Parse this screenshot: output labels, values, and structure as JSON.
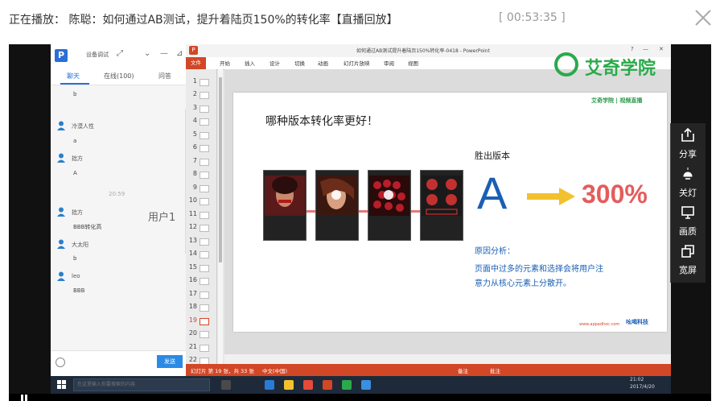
{
  "header": {
    "now_playing": "正在播放： 陈聪：如何通过AB测试，提升着陆页150%的转化率【直播回放】",
    "elapsed": "[ 00:53:35 ]"
  },
  "chat": {
    "device_test": "设备调试",
    "tabs": [
      "聊天",
      "在线(100)",
      "问答"
    ],
    "messages": [
      {
        "name": "",
        "text": "b"
      },
      {
        "name": "冷漠人性",
        "text": "a"
      },
      {
        "name": "拙方",
        "text": "A"
      },
      {
        "name": "拙方",
        "text": "BBB转化高"
      },
      {
        "name": "大太阳",
        "text": "b"
      },
      {
        "name": "leo",
        "text": "BBB"
      }
    ],
    "time_divider": "20:59",
    "send_label": "发送"
  },
  "overlay_user": "用户1",
  "ppt": {
    "window_title": "如何通过AB测试提升着陆页150%转化率-0418 - PowerPoint",
    "ribbon_tabs": [
      "文件",
      "开始",
      "插入",
      "设计",
      "切换",
      "动画",
      "幻灯片放映",
      "审阅",
      "视图"
    ],
    "slide_numbers": [
      "1",
      "2",
      "3",
      "4",
      "5",
      "6",
      "7",
      "8",
      "9",
      "10",
      "11",
      "12",
      "13",
      "14",
      "15",
      "16",
      "17",
      "18",
      "19",
      "20",
      "21",
      "22"
    ],
    "active_slide": "19",
    "status_slide": "幻灯片 第 19 张，共 33 张",
    "status_lang": "中文(中国)",
    "status_notes": "备注",
    "status_comments": "批注"
  },
  "slide": {
    "title": "哪种版本转化率更好！",
    "winner_label": "胜出版本",
    "winner": "A",
    "uplift": "300%",
    "analysis_title": "原因分析：",
    "analysis_lines": [
      "页面中过多的元素和选择会将用户注",
      "意力从核心元素上分散开。"
    ],
    "url": "www.appadhoc.com",
    "top_logo": "艾奇学院 | 视频直播",
    "footer_logo": "吆喝科技"
  },
  "watermark": "艾奇学院",
  "side_tools": [
    "分享",
    "关灯",
    "画质",
    "宽屏"
  ],
  "taskbar": {
    "search_placeholder": "在这里输入你要搜索的内容",
    "clock": "21:02",
    "date": "2017/4/20"
  },
  "colors": {
    "ppt_accent": "#d24726",
    "brand_green": "#2aaa4a",
    "slide_blue": "#1a5fb4",
    "uplift_red": "#e45c5c",
    "chat_blue": "#2a6fd6"
  }
}
